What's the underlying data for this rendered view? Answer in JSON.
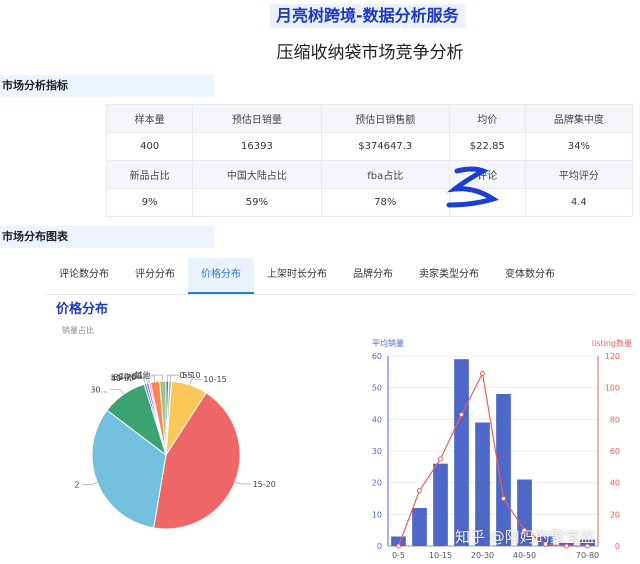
{
  "header": {
    "brand": "月亮树跨境-数据分析服务",
    "title": "压缩收纳袋市场竞争分析"
  },
  "sections": {
    "metrics": "市场分析指标",
    "charts": "市场分布图表"
  },
  "metrics": {
    "row1_labels": [
      "样本量",
      "预估日销量",
      "预估日销售额",
      "均价",
      "品牌集中度"
    ],
    "row1_values": [
      "400",
      "16393",
      "$374647.3",
      "$22.85",
      "34%"
    ],
    "row2_labels": [
      "新品占比",
      "中国大陆占比",
      "fba占比",
      "评论",
      "平均评分"
    ],
    "row2_values": [
      "9%",
      "59%",
      "78%",
      "",
      "4.4"
    ]
  },
  "tabs": [
    "评论数分布",
    "评分分布",
    "价格分布",
    "上架时长分布",
    "品牌分布",
    "卖家类型分布",
    "变体数分布"
  ],
  "active_tab": "价格分布",
  "chart_section_title": "价格分布",
  "pie_subtitle": "销量占比",
  "watermark": "知乎 @阳妈的聚宝盆",
  "colors": {
    "accent": "#2a7bd6",
    "bar": "#4f67c9",
    "line": "#e8605e"
  },
  "chart_data": [
    {
      "type": "pie",
      "title": "销量占比",
      "slices": [
        {
          "label": "0-5",
          "value": 0.6,
          "color": "#5470c6"
        },
        {
          "label": "5-10",
          "value": 0.6,
          "color": "#91cc75"
        },
        {
          "label": "10-15",
          "value": 8,
          "color": "#fac858"
        },
        {
          "label": "15-20",
          "value": 44,
          "color": "#ee6666"
        },
        {
          "label": "2",
          "value": 33,
          "color": "#73c0de"
        },
        {
          "label": "30...",
          "value": 10,
          "color": "#3ba272"
        },
        {
          "label": "40-...",
          "value": 0.5,
          "color": "#5470c6"
        },
        {
          "label": "50-60",
          "value": 0.5,
          "color": "#9a60b4"
        },
        {
          "label": "60-70",
          "value": 0.4,
          "color": "#ea7ccc"
        },
        {
          "label": "70-80",
          "value": 2,
          "color": "#fc8452"
        },
        {
          "label": "其他",
          "value": 1.4,
          "color": "#9ec67a"
        }
      ]
    },
    {
      "type": "bar",
      "categories": [
        "0-5",
        "5-10",
        "10-15",
        "15-20",
        "20-30",
        "30-40",
        "40-50",
        "50-60",
        "60-70",
        "70-80"
      ],
      "x_tick_labels": [
        "0-5",
        "10-15",
        "20-30",
        "40-50",
        "70-80"
      ],
      "series": [
        {
          "name": "平均销量",
          "type": "bar",
          "axis": "left",
          "values": [
            3,
            12,
            26,
            59,
            39,
            48,
            21,
            3,
            1,
            2
          ]
        },
        {
          "name": "listing数量",
          "type": "line",
          "axis": "right",
          "values": [
            0,
            35,
            55,
            83,
            109,
            30,
            10,
            1,
            0,
            0
          ]
        }
      ],
      "left_axis": {
        "label": "平均销量",
        "ylim": [
          0,
          60
        ],
        "ticks": [
          0,
          10,
          20,
          30,
          40,
          50,
          60
        ]
      },
      "right_axis": {
        "label": "listing数量",
        "ylim": [
          0,
          120
        ],
        "ticks": [
          0,
          20,
          40,
          60,
          80,
          100,
          120
        ]
      },
      "grid": true
    }
  ]
}
